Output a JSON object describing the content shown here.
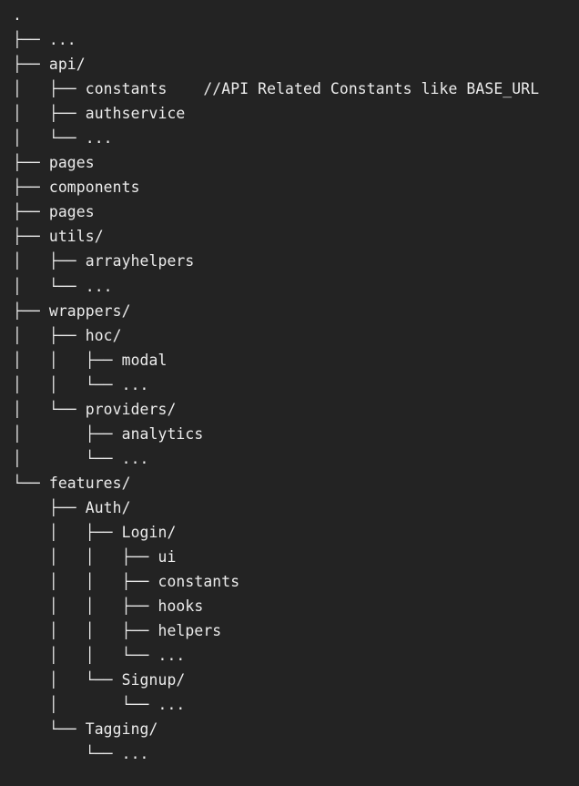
{
  "code_block": {
    "language": "plaintext",
    "lines": [
      {
        "prefix": "",
        "name": ".",
        "comment": ""
      },
      {
        "prefix": "├── ",
        "name": "...",
        "comment": ""
      },
      {
        "prefix": "├── ",
        "name": "api/",
        "comment": ""
      },
      {
        "prefix": "│   ├── ",
        "name": "constants",
        "comment": "    //API Related Constants like BASE_URL"
      },
      {
        "prefix": "│   ├── ",
        "name": "authservice",
        "comment": ""
      },
      {
        "prefix": "│   └── ",
        "name": "...",
        "comment": ""
      },
      {
        "prefix": "├── ",
        "name": "pages",
        "comment": ""
      },
      {
        "prefix": "├── ",
        "name": "components",
        "comment": ""
      },
      {
        "prefix": "├── ",
        "name": "pages",
        "comment": ""
      },
      {
        "prefix": "├── ",
        "name": "utils/",
        "comment": ""
      },
      {
        "prefix": "│   ├── ",
        "name": "arrayhelpers",
        "comment": ""
      },
      {
        "prefix": "│   └── ",
        "name": "...",
        "comment": ""
      },
      {
        "prefix": "├── ",
        "name": "wrappers/",
        "comment": ""
      },
      {
        "prefix": "│   ├── ",
        "name": "hoc/",
        "comment": ""
      },
      {
        "prefix": "│   │   ├── ",
        "name": "modal",
        "comment": ""
      },
      {
        "prefix": "│   │   └── ",
        "name": "...",
        "comment": ""
      },
      {
        "prefix": "│   └── ",
        "name": "providers/",
        "comment": ""
      },
      {
        "prefix": "│       ├── ",
        "name": "analytics",
        "comment": ""
      },
      {
        "prefix": "│       └── ",
        "name": "...",
        "comment": ""
      },
      {
        "prefix": "└── ",
        "name": "features/",
        "comment": ""
      },
      {
        "prefix": "    ├── ",
        "name": "Auth/",
        "comment": ""
      },
      {
        "prefix": "    │   ├── ",
        "name": "Login/",
        "comment": ""
      },
      {
        "prefix": "    │   │   ├── ",
        "name": "ui",
        "comment": ""
      },
      {
        "prefix": "    │   │   ├── ",
        "name": "constants",
        "comment": ""
      },
      {
        "prefix": "    │   │   ├── ",
        "name": "hooks",
        "comment": ""
      },
      {
        "prefix": "    │   │   ├── ",
        "name": "helpers",
        "comment": ""
      },
      {
        "prefix": "    │   │   └── ",
        "name": "...",
        "comment": ""
      },
      {
        "prefix": "    │   └── ",
        "name": "Signup/",
        "comment": ""
      },
      {
        "prefix": "    │       └── ",
        "name": "...",
        "comment": ""
      },
      {
        "prefix": "    └── ",
        "name": "Tagging/",
        "comment": ""
      },
      {
        "prefix": "        └── ",
        "name": "...",
        "comment": ""
      }
    ]
  },
  "colors": {
    "background": "#232323",
    "text": "#e8e8e8"
  }
}
